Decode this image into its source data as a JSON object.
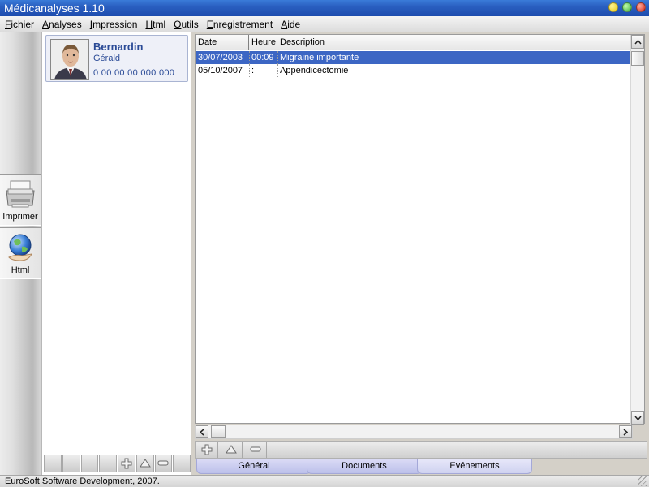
{
  "window": {
    "title": "Médicanalyses 1.10"
  },
  "menu": [
    "Fichier",
    "Analyses",
    "Impression",
    "Html",
    "Outils",
    "Enregistrement",
    "Aide"
  ],
  "tools": [
    {
      "label": "Imprimer",
      "icon": "printer-icon"
    },
    {
      "label": "Html",
      "icon": "globe-icon"
    }
  ],
  "patient": {
    "last_name": "Bernardin",
    "first_name": "Gérald",
    "ssn": "0 00 00 00 000 000"
  },
  "grid": {
    "columns": [
      "Date",
      "Heure",
      "Description"
    ],
    "rows": [
      {
        "date": "30/07/2003",
        "time": "00:09",
        "description": "Migraine importante",
        "selected": true
      },
      {
        "date": "05/10/2007",
        "time": ":",
        "description": "Appendicectomie",
        "selected": false
      }
    ]
  },
  "tabs": [
    "Général",
    "Documents",
    "Evénements"
  ],
  "status": {
    "text": "EuroSoft Software Development, 2007."
  },
  "colors": {
    "titlebar": "#2a5fc0",
    "selection": "#3c66c4",
    "patient_text": "#2a4a96",
    "tab": "#bcc0ea"
  }
}
